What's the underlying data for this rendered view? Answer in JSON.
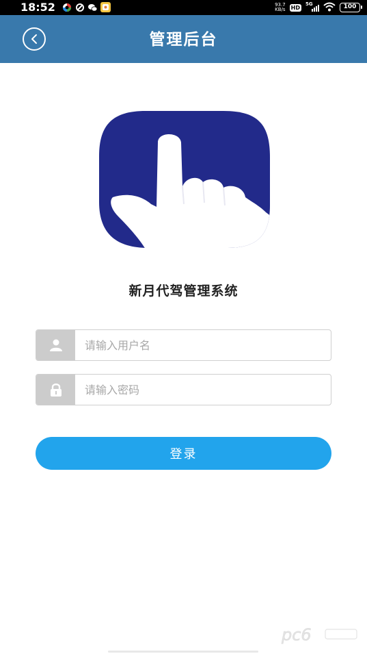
{
  "status_bar": {
    "time": "18:52",
    "net_speed_value": "93.7",
    "net_speed_unit": "KB/s",
    "hd_label": "HD",
    "signal_label": "5G",
    "battery": "100"
  },
  "header": {
    "title": "管理后台",
    "background_color": "#3979ac"
  },
  "logo": {
    "background_color": "#222a8a",
    "icon": "pointing-hand-icon"
  },
  "app_name": "新月代驾管理系统",
  "form": {
    "username_placeholder": "请输入用户名",
    "username_value": "",
    "password_placeholder": "请输入密码",
    "password_value": "",
    "login_label": "登录",
    "login_color": "#22a4ec"
  },
  "watermark": {
    "text": "pc6"
  }
}
